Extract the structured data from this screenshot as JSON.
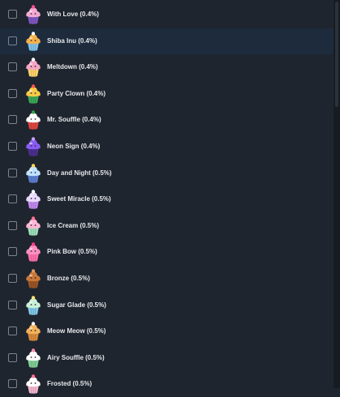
{
  "list": {
    "items": [
      {
        "label": "With Love (0.4%)",
        "icon": "cupcake-with-love-icon",
        "frosting": "#f2a9d2",
        "wrapper": "#7e57c2",
        "topper": "#ff4d8d",
        "highlight": false,
        "checked": false
      },
      {
        "label": "Shiba Inu (0.4%)",
        "icon": "cupcake-shiba-inu-icon",
        "frosting": "#f5b04b",
        "wrapper": "#7fc1ea",
        "topper": "#ffffff",
        "highlight": true,
        "checked": false
      },
      {
        "label": "Meltdown (0.4%)",
        "icon": "cupcake-meltdown-icon",
        "frosting": "#f4a6c4",
        "wrapper": "#ffd36a",
        "topper": "#ffffff",
        "highlight": false,
        "checked": false
      },
      {
        "label": "Party Clown (0.4%)",
        "icon": "cupcake-party-clown-icon",
        "frosting": "#f7c948",
        "wrapper": "#3aa657",
        "topper": "#ff5252",
        "highlight": false,
        "checked": false
      },
      {
        "label": "Mr. Souffle (0.4%)",
        "icon": "cupcake-mr-souffle-icon",
        "frosting": "#ffffff",
        "wrapper": "#e0453f",
        "topper": "#2ea043",
        "highlight": false,
        "checked": false
      },
      {
        "label": "Neon Sign (0.4%)",
        "icon": "cupcake-neon-sign-icon",
        "frosting": "#8a5cf6",
        "wrapper": "#4a2f8f",
        "topper": "#c9a0ff",
        "highlight": false,
        "checked": false
      },
      {
        "label": "Day and Night (0.5%)",
        "icon": "cupcake-day-and-night-icon",
        "frosting": "#bfe3ff",
        "wrapper": "#5c7fd1",
        "topper": "#ffd54f",
        "highlight": false,
        "checked": false
      },
      {
        "label": "Sweet Miracle (0.5%)",
        "icon": "cupcake-sweet-miracle-icon",
        "frosting": "#e8d9ff",
        "wrapper": "#c388f0",
        "topper": "#ffffff",
        "highlight": false,
        "checked": false
      },
      {
        "label": "Ice Cream (0.5%)",
        "icon": "cupcake-ice-cream-icon",
        "frosting": "#ffb7d5",
        "wrapper": "#9be0b8",
        "topper": "#ff6f91",
        "highlight": false,
        "checked": false
      },
      {
        "label": "Pink Bow (0.5%)",
        "icon": "cupcake-pink-bow-icon",
        "frosting": "#ff8fc2",
        "wrapper": "#ff6fae",
        "topper": "#ff3d8b",
        "highlight": false,
        "checked": false
      },
      {
        "label": "Bronze (0.5%)",
        "icon": "cupcake-bronze-icon",
        "frosting": "#c8773a",
        "wrapper": "#9a5526",
        "topper": "#e39a5d",
        "highlight": false,
        "checked": false
      },
      {
        "label": "Sugar Glade (0.5%)",
        "icon": "cupcake-sugar-glade-icon",
        "frosting": "#c9f0d6",
        "wrapper": "#7fc7e8",
        "topper": "#ffe27a",
        "highlight": false,
        "checked": false
      },
      {
        "label": "Meow Meow (0.5%)",
        "icon": "cupcake-meow-meow-icon",
        "frosting": "#f3b25a",
        "wrapper": "#d98a3c",
        "topper": "#ffffff",
        "highlight": false,
        "checked": false
      },
      {
        "label": "Airy Souffle (0.5%)",
        "icon": "cupcake-airy-souffle-icon",
        "frosting": "#ffffff",
        "wrapper": "#7fcf96",
        "topper": "#ff8fb1",
        "highlight": false,
        "checked": false
      },
      {
        "label": "Frosted (0.5%)",
        "icon": "cupcake-frosted-icon",
        "frosting": "#ffffff",
        "wrapper": "#f4b6cf",
        "topper": "#ff6f91",
        "highlight": false,
        "checked": false
      }
    ]
  },
  "colors": {
    "background": "#1f252f",
    "highlight_row": "#1d2b3d",
    "text": "#e6e8eb",
    "checkbox_border": "#7c838d",
    "scrollbar_thumb": "#2c323b"
  }
}
